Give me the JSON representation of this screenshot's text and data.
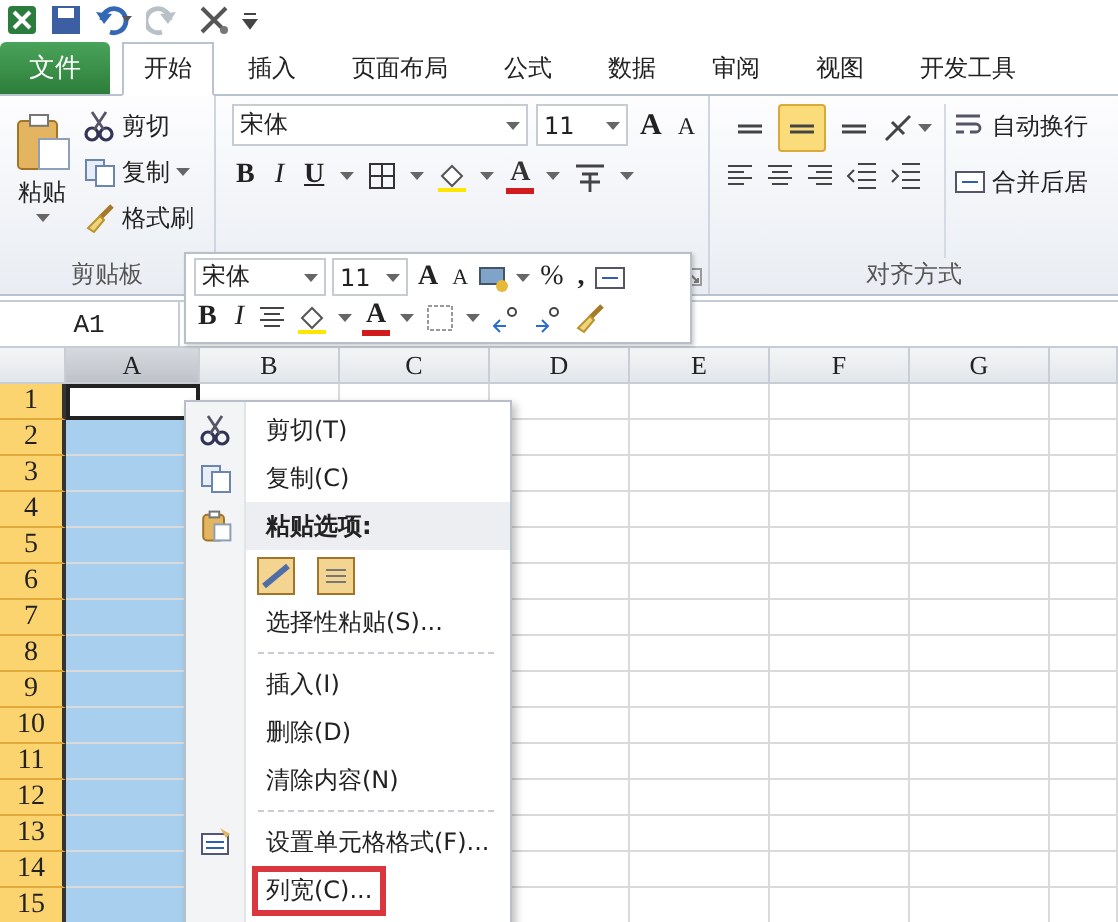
{
  "tabs": [
    {
      "label": "文件",
      "kind": "file",
      "selected": false
    },
    {
      "label": "开始",
      "kind": "tab",
      "selected": true
    },
    {
      "label": "插入",
      "kind": "tab",
      "selected": false
    },
    {
      "label": "页面布局",
      "kind": "tab",
      "selected": false
    },
    {
      "label": "公式",
      "kind": "tab",
      "selected": false
    },
    {
      "label": "数据",
      "kind": "tab",
      "selected": false
    },
    {
      "label": "审阅",
      "kind": "tab",
      "selected": false
    },
    {
      "label": "视图",
      "kind": "tab",
      "selected": false
    },
    {
      "label": "开发工具",
      "kind": "tab",
      "selected": false
    }
  ],
  "clipboard": {
    "paste": "粘贴",
    "cut": "剪切",
    "copy": "复制",
    "format_painter": "格式刷",
    "label": "剪贴板"
  },
  "font": {
    "name": "宋体",
    "size": "11",
    "grow": "A",
    "shrink": "A",
    "bold": "B",
    "italic": "I",
    "underline": "U",
    "color_letter": "A"
  },
  "alignment": {
    "valign": [
      {
        "selected": false
      },
      {
        "selected": true
      },
      {
        "selected": false
      }
    ],
    "wrap": "自动换行",
    "merge": "合并后居",
    "label": "对齐方式"
  },
  "mini_toolbar": {
    "font": "宋体",
    "size": "11",
    "grow": "A",
    "shrink": "A",
    "percent": "%",
    "comma": ",",
    "bold": "B",
    "italic": "I",
    "color_letter": "A"
  },
  "formula_bar": {
    "name_box": "A1"
  },
  "sheet": {
    "columns": [
      {
        "label": "A",
        "selected": true
      },
      {
        "label": "B",
        "selected": false
      },
      {
        "label": "C",
        "selected": false
      },
      {
        "label": "D",
        "selected": false
      },
      {
        "label": "E",
        "selected": false
      },
      {
        "label": "F",
        "selected": false
      },
      {
        "label": "G",
        "selected": false
      }
    ],
    "rows": [
      {
        "label": "1",
        "active": true
      },
      {
        "label": "2",
        "active": false
      },
      {
        "label": "3",
        "active": false
      },
      {
        "label": "4",
        "active": false
      },
      {
        "label": "5",
        "active": false
      },
      {
        "label": "6",
        "active": false
      },
      {
        "label": "7",
        "active": false
      },
      {
        "label": "8",
        "active": false
      },
      {
        "label": "9",
        "active": false
      },
      {
        "label": "10",
        "active": false
      },
      {
        "label": "11",
        "active": false
      },
      {
        "label": "12",
        "active": false
      },
      {
        "label": "13",
        "active": false
      },
      {
        "label": "14",
        "active": false
      },
      {
        "label": "15",
        "active": false
      }
    ]
  },
  "context_menu": {
    "items": [
      {
        "kind": "cut",
        "label": "剪切(T)",
        "outlined": false
      },
      {
        "kind": "copy",
        "label": "复制(C)",
        "outlined": false
      },
      {
        "kind": "paste_header",
        "label": "粘贴选项:",
        "outlined": false
      },
      {
        "kind": "paste_options"
      },
      {
        "kind": "command",
        "label": "选择性粘贴(S)...",
        "outlined": false
      },
      {
        "kind": "separator"
      },
      {
        "kind": "command",
        "label": "插入(I)",
        "outlined": false
      },
      {
        "kind": "command",
        "label": "删除(D)",
        "outlined": false
      },
      {
        "kind": "command",
        "label": "清除内容(N)",
        "outlined": false
      },
      {
        "kind": "separator"
      },
      {
        "kind": "format",
        "label": "设置单元格格式(F)...",
        "outlined": false
      },
      {
        "kind": "command",
        "label": "列宽(C)...",
        "outlined": true
      }
    ]
  }
}
